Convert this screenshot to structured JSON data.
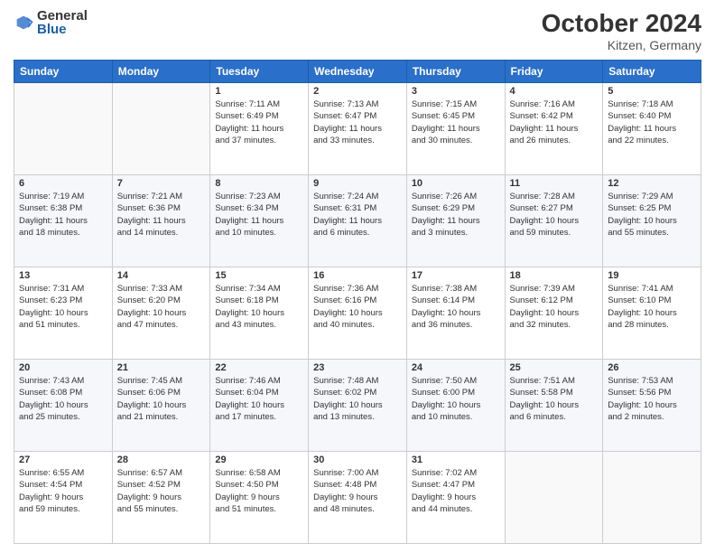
{
  "header": {
    "logo": {
      "general": "General",
      "blue": "Blue"
    },
    "title": "October 2024",
    "location": "Kitzen, Germany"
  },
  "weekdays": [
    "Sunday",
    "Monday",
    "Tuesday",
    "Wednesday",
    "Thursday",
    "Friday",
    "Saturday"
  ],
  "weeks": [
    [
      {
        "day": "",
        "content": ""
      },
      {
        "day": "",
        "content": ""
      },
      {
        "day": "1",
        "content": "Sunrise: 7:11 AM\nSunset: 6:49 PM\nDaylight: 11 hours\nand 37 minutes."
      },
      {
        "day": "2",
        "content": "Sunrise: 7:13 AM\nSunset: 6:47 PM\nDaylight: 11 hours\nand 33 minutes."
      },
      {
        "day": "3",
        "content": "Sunrise: 7:15 AM\nSunset: 6:45 PM\nDaylight: 11 hours\nand 30 minutes."
      },
      {
        "day": "4",
        "content": "Sunrise: 7:16 AM\nSunset: 6:42 PM\nDaylight: 11 hours\nand 26 minutes."
      },
      {
        "day": "5",
        "content": "Sunrise: 7:18 AM\nSunset: 6:40 PM\nDaylight: 11 hours\nand 22 minutes."
      }
    ],
    [
      {
        "day": "6",
        "content": "Sunrise: 7:19 AM\nSunset: 6:38 PM\nDaylight: 11 hours\nand 18 minutes."
      },
      {
        "day": "7",
        "content": "Sunrise: 7:21 AM\nSunset: 6:36 PM\nDaylight: 11 hours\nand 14 minutes."
      },
      {
        "day": "8",
        "content": "Sunrise: 7:23 AM\nSunset: 6:34 PM\nDaylight: 11 hours\nand 10 minutes."
      },
      {
        "day": "9",
        "content": "Sunrise: 7:24 AM\nSunset: 6:31 PM\nDaylight: 11 hours\nand 6 minutes."
      },
      {
        "day": "10",
        "content": "Sunrise: 7:26 AM\nSunset: 6:29 PM\nDaylight: 11 hours\nand 3 minutes."
      },
      {
        "day": "11",
        "content": "Sunrise: 7:28 AM\nSunset: 6:27 PM\nDaylight: 10 hours\nand 59 minutes."
      },
      {
        "day": "12",
        "content": "Sunrise: 7:29 AM\nSunset: 6:25 PM\nDaylight: 10 hours\nand 55 minutes."
      }
    ],
    [
      {
        "day": "13",
        "content": "Sunrise: 7:31 AM\nSunset: 6:23 PM\nDaylight: 10 hours\nand 51 minutes."
      },
      {
        "day": "14",
        "content": "Sunrise: 7:33 AM\nSunset: 6:20 PM\nDaylight: 10 hours\nand 47 minutes."
      },
      {
        "day": "15",
        "content": "Sunrise: 7:34 AM\nSunset: 6:18 PM\nDaylight: 10 hours\nand 43 minutes."
      },
      {
        "day": "16",
        "content": "Sunrise: 7:36 AM\nSunset: 6:16 PM\nDaylight: 10 hours\nand 40 minutes."
      },
      {
        "day": "17",
        "content": "Sunrise: 7:38 AM\nSunset: 6:14 PM\nDaylight: 10 hours\nand 36 minutes."
      },
      {
        "day": "18",
        "content": "Sunrise: 7:39 AM\nSunset: 6:12 PM\nDaylight: 10 hours\nand 32 minutes."
      },
      {
        "day": "19",
        "content": "Sunrise: 7:41 AM\nSunset: 6:10 PM\nDaylight: 10 hours\nand 28 minutes."
      }
    ],
    [
      {
        "day": "20",
        "content": "Sunrise: 7:43 AM\nSunset: 6:08 PM\nDaylight: 10 hours\nand 25 minutes."
      },
      {
        "day": "21",
        "content": "Sunrise: 7:45 AM\nSunset: 6:06 PM\nDaylight: 10 hours\nand 21 minutes."
      },
      {
        "day": "22",
        "content": "Sunrise: 7:46 AM\nSunset: 6:04 PM\nDaylight: 10 hours\nand 17 minutes."
      },
      {
        "day": "23",
        "content": "Sunrise: 7:48 AM\nSunset: 6:02 PM\nDaylight: 10 hours\nand 13 minutes."
      },
      {
        "day": "24",
        "content": "Sunrise: 7:50 AM\nSunset: 6:00 PM\nDaylight: 10 hours\nand 10 minutes."
      },
      {
        "day": "25",
        "content": "Sunrise: 7:51 AM\nSunset: 5:58 PM\nDaylight: 10 hours\nand 6 minutes."
      },
      {
        "day": "26",
        "content": "Sunrise: 7:53 AM\nSunset: 5:56 PM\nDaylight: 10 hours\nand 2 minutes."
      }
    ],
    [
      {
        "day": "27",
        "content": "Sunrise: 6:55 AM\nSunset: 4:54 PM\nDaylight: 9 hours\nand 59 minutes."
      },
      {
        "day": "28",
        "content": "Sunrise: 6:57 AM\nSunset: 4:52 PM\nDaylight: 9 hours\nand 55 minutes."
      },
      {
        "day": "29",
        "content": "Sunrise: 6:58 AM\nSunset: 4:50 PM\nDaylight: 9 hours\nand 51 minutes."
      },
      {
        "day": "30",
        "content": "Sunrise: 7:00 AM\nSunset: 4:48 PM\nDaylight: 9 hours\nand 48 minutes."
      },
      {
        "day": "31",
        "content": "Sunrise: 7:02 AM\nSunset: 4:47 PM\nDaylight: 9 hours\nand 44 minutes."
      },
      {
        "day": "",
        "content": ""
      },
      {
        "day": "",
        "content": ""
      }
    ]
  ]
}
